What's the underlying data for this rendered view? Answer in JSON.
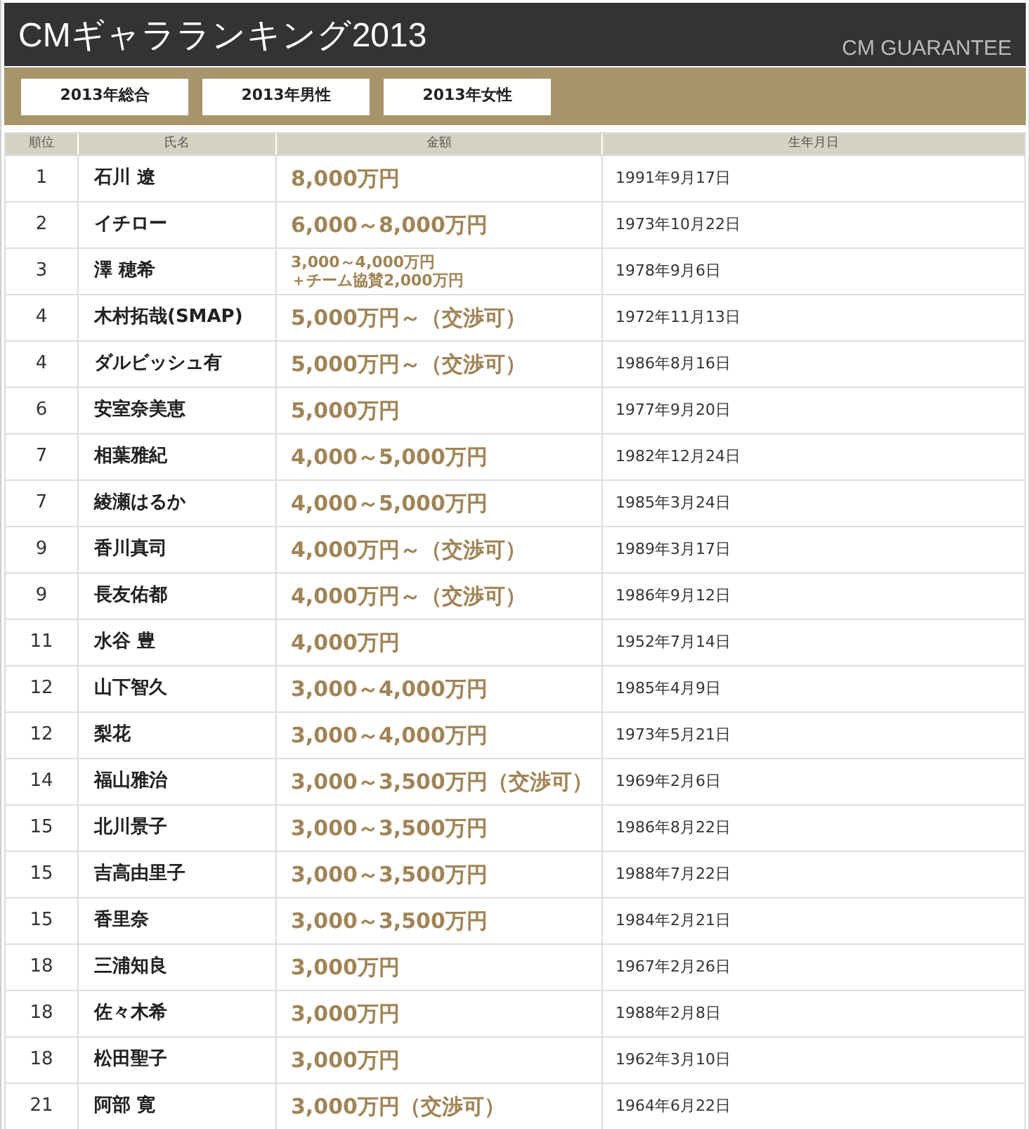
{
  "header": {
    "title": "CMギャラランキング2013",
    "subtitle": "CM GUARANTEE"
  },
  "tabs": [
    {
      "label": "2013年総合"
    },
    {
      "label": "2013年男性"
    },
    {
      "label": "2013年女性"
    }
  ],
  "table": {
    "columns": [
      "順位",
      "氏名",
      "金額",
      "生年月日"
    ],
    "rows": [
      {
        "rank": "1",
        "name": "石川 遼",
        "fee": "8,000万円",
        "kind": "main",
        "birth": "1991年9月17日"
      },
      {
        "rank": "2",
        "name": "イチロー",
        "fee": "6,000～8,000万円",
        "kind": "main",
        "birth": "1973年10月22日"
      },
      {
        "rank": "3",
        "name": "澤 穂希",
        "fee": "3,000～4,000万円",
        "note": "＋チーム協賛2,000万円",
        "kind": "note",
        "birth": "1978年9月6日"
      },
      {
        "rank": "4",
        "name": "木村拓哉(SMAP)",
        "fee": "5,000万円～（交渉可）",
        "kind": "main",
        "birth": "1972年11月13日"
      },
      {
        "rank": "4",
        "name": "ダルビッシュ有",
        "fee": "5,000万円～（交渉可）",
        "kind": "main",
        "birth": "1986年8月16日"
      },
      {
        "rank": "6",
        "name": "安室奈美恵",
        "fee": "5,000万円",
        "kind": "main",
        "birth": "1977年9月20日"
      },
      {
        "rank": "7",
        "name": "相葉雅紀",
        "fee": "4,000～5,000万円",
        "kind": "main",
        "birth": "1982年12月24日"
      },
      {
        "rank": "7",
        "name": "綾瀬はるか",
        "fee": "4,000～5,000万円",
        "kind": "main",
        "birth": "1985年3月24日"
      },
      {
        "rank": "9",
        "name": "香川真司",
        "fee": "4,000万円～（交渉可）",
        "kind": "main",
        "birth": "1989年3月17日"
      },
      {
        "rank": "9",
        "name": "長友佑都",
        "fee": "4,000万円～（交渉可）",
        "kind": "main",
        "birth": "1986年9月12日"
      },
      {
        "rank": "11",
        "name": "水谷 豊",
        "fee": "4,000万円",
        "kind": "main",
        "birth": "1952年7月14日"
      },
      {
        "rank": "12",
        "name": "山下智久",
        "fee": "3,000～4,000万円",
        "kind": "main",
        "birth": "1985年4月9日"
      },
      {
        "rank": "12",
        "name": "梨花",
        "fee": "3,000～4,000万円",
        "kind": "main",
        "birth": "1973年5月21日"
      },
      {
        "rank": "14",
        "name": "福山雅治",
        "fee": "3,000～3,500万円（交渉可）",
        "kind": "main",
        "birth": "1969年2月6日"
      },
      {
        "rank": "15",
        "name": "北川景子",
        "fee": "3,000～3,500万円",
        "kind": "main",
        "birth": "1986年8月22日"
      },
      {
        "rank": "15",
        "name": "吉高由里子",
        "fee": "3,000～3,500万円",
        "kind": "main",
        "birth": "1988年7月22日"
      },
      {
        "rank": "15",
        "name": "香里奈",
        "fee": "3,000～3,500万円",
        "kind": "main",
        "birth": "1984年2月21日"
      },
      {
        "rank": "18",
        "name": "三浦知良",
        "fee": "3,000万円",
        "kind": "main",
        "birth": "1967年2月26日"
      },
      {
        "rank": "18",
        "name": "佐々木希",
        "fee": "3,000万円",
        "kind": "main",
        "birth": "1988年2月8日"
      },
      {
        "rank": "18",
        "name": "松田聖子",
        "fee": "3,000万円",
        "kind": "main",
        "birth": "1962年3月10日"
      },
      {
        "rank": "21",
        "name": "阿部 寛",
        "fee": "3,000万円（交渉可）",
        "kind": "main",
        "birth": "1964年6月22日"
      }
    ]
  }
}
